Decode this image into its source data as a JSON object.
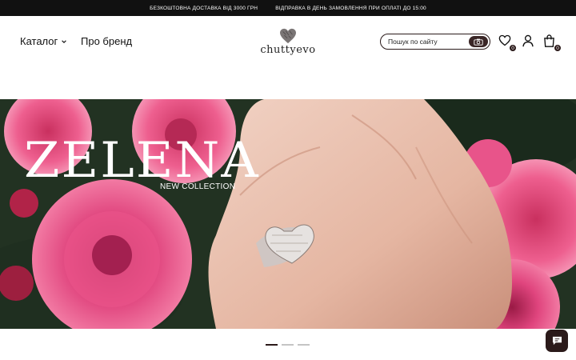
{
  "topbar": {
    "promo_delivery": "БЕЗКОШТОВНА ДОСТАВКА ВІД 3000 ГРН",
    "promo_dispatch": "ВІДПРАВКА В ДЕНЬ ЗАМОВЛЕННЯ ПРИ ОПЛАТІ ДО 15:00"
  },
  "header": {
    "nav": {
      "catalog_label": "Каталог",
      "brand_label": "Про бренд"
    },
    "logo_text": "chuttyevo",
    "search": {
      "placeholder": "Пошук по сайту",
      "value": ""
    },
    "wishlist_count": "0",
    "cart_count": "0"
  },
  "hero": {
    "title": "ZELENA",
    "subtitle": "NEW COLLECTION",
    "slides_total": 3,
    "active_slide": 1
  },
  "icons": {
    "catalog_chevron": "chevron-down-icon",
    "logo_mark": "heart-logo-icon",
    "search_camera": "camera-icon",
    "wishlist": "heart-icon",
    "user": "user-icon",
    "cart": "shopping-bag-icon",
    "chat": "chat-icon"
  },
  "colors": {
    "topbar_bg": "#111111",
    "accent": "#2b1a1a",
    "hero_flowers": "#e0457e",
    "hero_foliage": "#2a3a2a"
  }
}
